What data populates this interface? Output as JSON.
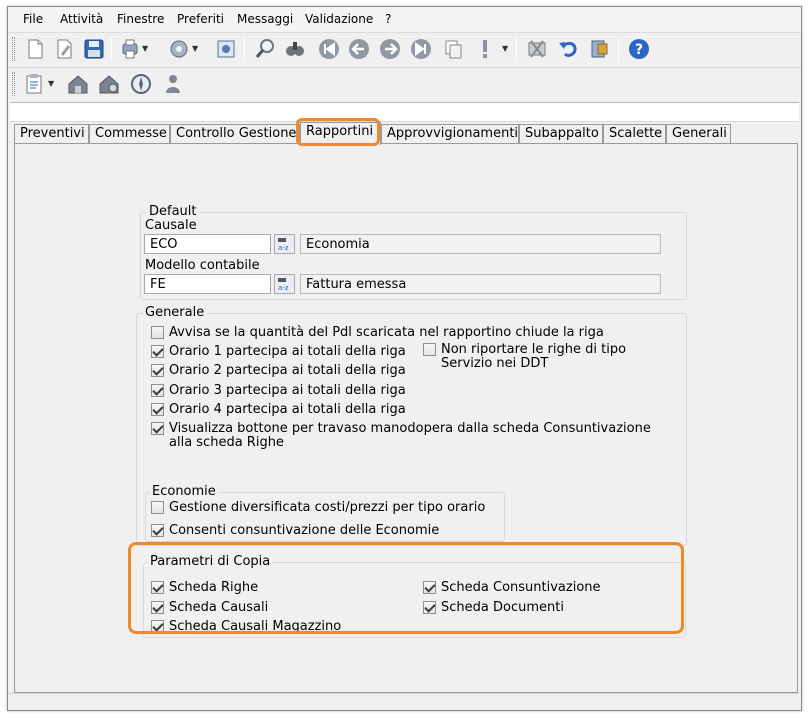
{
  "menu": [
    "File",
    "Attività",
    "Finestre",
    "Preferiti",
    "Messaggi",
    "Validazione",
    "?"
  ],
  "toolbar1_icons": [
    "new-document-icon",
    "edit-document-icon",
    "save-icon",
    "print-icon",
    "process-icon",
    "settings-icon",
    "search-icon",
    "binoculars-icon",
    "first-record-icon",
    "previous-record-icon",
    "next-record-icon",
    "last-record-icon",
    "copy-icon",
    "alert-icon",
    "delete-icon",
    "undo-icon",
    "exit-icon",
    "help-icon"
  ],
  "toolbar2_icons": [
    "clipboard-icon",
    "home-network-icon",
    "home-settings-icon",
    "compass-icon",
    "user-icon"
  ],
  "tabs": [
    "Preventivi",
    "Commesse",
    "Controllo Gestione",
    "Rapportini",
    "Approvvigionamenti",
    "Subappalto",
    "Scalette",
    "Generali"
  ],
  "active_tab": "Rapportini",
  "default": {
    "title": "Default",
    "causale_label": "Causale",
    "causale_code": "ECO",
    "causale_desc": "Economia",
    "modello_label": "Modello contabile",
    "modello_code": "FE",
    "modello_desc": "Fattura emessa"
  },
  "generale": {
    "title": "Generale",
    "options": [
      {
        "label": "Avvisa se la quantità del Pdl scaricata nel rapportino chiude la riga",
        "checked": false
      },
      {
        "label": "Orario 1 partecipa ai totali della riga",
        "checked": true
      },
      {
        "label": "Orario 2 partecipa ai totali della riga",
        "checked": true
      },
      {
        "label": "Orario 3 partecipa ai totali della riga",
        "checked": true
      },
      {
        "label": "Orario 4 partecipa ai totali della riga",
        "checked": true
      },
      {
        "label": "Visualizza bottone per travaso manodopera dalla scheda Consuntivazione",
        "label2": "alla scheda Righe",
        "checked": true
      }
    ],
    "non_riportare": {
      "label": "Non riportare le righe di tipo",
      "label2": "Servizio nei DDT",
      "checked": false
    }
  },
  "economie": {
    "title": "Economie",
    "options": [
      {
        "label": "Gestione diversificata costi/prezzi per tipo orario",
        "checked": false
      },
      {
        "label": "Consenti consuntivazione delle Economie",
        "checked": true
      }
    ]
  },
  "parametri": {
    "title": "Parametri di Copia",
    "options": [
      {
        "label": "Scheda Righe",
        "checked": true
      },
      {
        "label": "Scheda Causali",
        "checked": true
      },
      {
        "label": "Scheda Causali Magazzino",
        "checked": true
      },
      {
        "label": "Scheda Consuntivazione",
        "checked": true
      },
      {
        "label": "Scheda Documenti",
        "checked": true
      }
    ]
  },
  "colors": {
    "highlight": "#f0892b",
    "window_bg": "#f0f0f0",
    "icon_blue": "#2b66c4"
  }
}
